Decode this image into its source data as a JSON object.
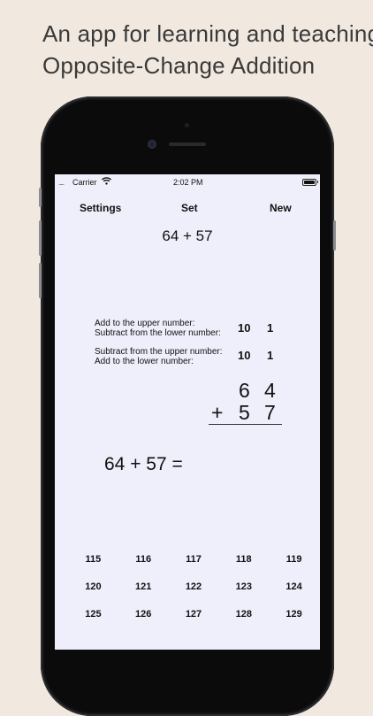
{
  "headline": {
    "line1": "An app for learning and teaching",
    "line2": "Opposite-Change Addition"
  },
  "status_bar": {
    "signal": ".....",
    "carrier": "Carrier",
    "wifi": "wifi-icon",
    "time": "2:02 PM"
  },
  "nav": {
    "settings": "Settings",
    "set": "Set",
    "new": "New"
  },
  "problem": "64 + 57",
  "adjust": {
    "row1": {
      "line1": "Add to the upper number:",
      "line2": "Subtract from the lower number:",
      "option1": "10",
      "option2": "1"
    },
    "row2": {
      "line1": "Subtract from the upper number:",
      "line2": "Add to the lower number:",
      "option1": "10",
      "option2": "1"
    }
  },
  "vertical": {
    "upper_tens": "6",
    "upper_ones": "4",
    "operator": "+",
    "lower_tens": "5",
    "lower_ones": "7"
  },
  "equation": "64 + 57 =",
  "answers": [
    "115",
    "116",
    "117",
    "118",
    "119",
    "120",
    "121",
    "122",
    "123",
    "124",
    "125",
    "126",
    "127",
    "128",
    "129"
  ]
}
